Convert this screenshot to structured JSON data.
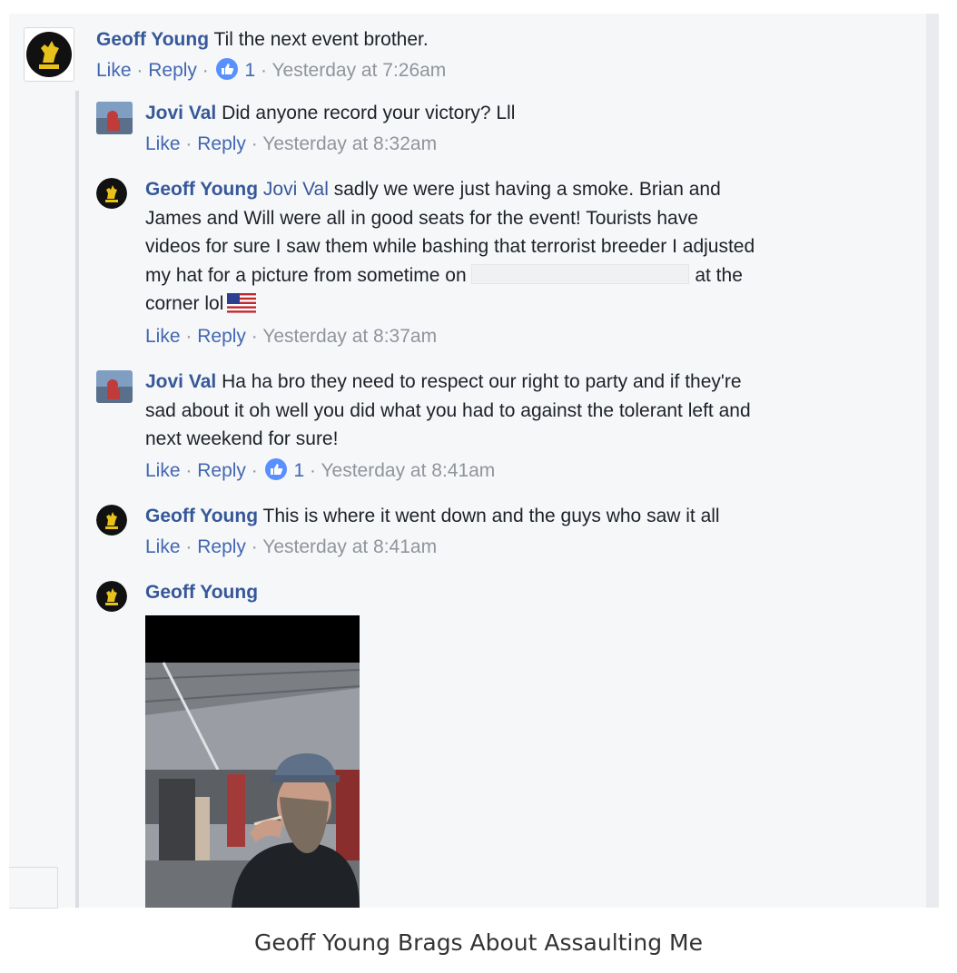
{
  "comments": [
    {
      "author": "Geoff Young",
      "text": "Til the next event brother.",
      "like": "Like",
      "reply": "Reply",
      "reactions": "1",
      "time": "Yesterday at 7:26am"
    },
    {
      "author": "Jovi Val",
      "text": "Did anyone record your victory? Lll",
      "like": "Like",
      "reply": "Reply",
      "time": "Yesterday at 8:32am"
    },
    {
      "author": "Geoff Young",
      "mention": "Jovi Val",
      "line1": "sadly we were just having a smoke. Brian and",
      "line2": "James and Will were all in good seats for the event! Tourists have",
      "line3": "videos for sure I saw them while bashing that terrorist breeder I adjusted",
      "line4_start": "my hat for a picture from sometime on",
      "line4_end": "at the",
      "line5": "corner lol",
      "emoji": "us-flag-icon",
      "like": "Like",
      "reply": "Reply",
      "time": "Yesterday at 8:37am"
    },
    {
      "author": "Jovi Val",
      "line1": "Ha ha bro they need to respect our right to party and if they're",
      "line2": "sad about it oh well you did what you had to against the tolerant left and",
      "line3": "next weekend for sure!",
      "like": "Like",
      "reply": "Reply",
      "reactions": "1",
      "time": "Yesterday at 8:41am"
    },
    {
      "author": "Geoff Young",
      "text": "This is where it went down and the guys who saw it all",
      "like": "Like",
      "reply": "Reply",
      "time": "Yesterday at 8:41am"
    },
    {
      "author": "Geoff Young",
      "attachment": "photo-of-man-smoking-under-canopy"
    }
  ],
  "separator": "·",
  "caption": "Geoff Young Brags About Assaulting Me",
  "colors": {
    "name": "#365899",
    "action": "#4267b2",
    "meta": "#90949c",
    "text": "#1d2129",
    "like_bubble": "#5890ff",
    "background": "#f6f7f9"
  }
}
